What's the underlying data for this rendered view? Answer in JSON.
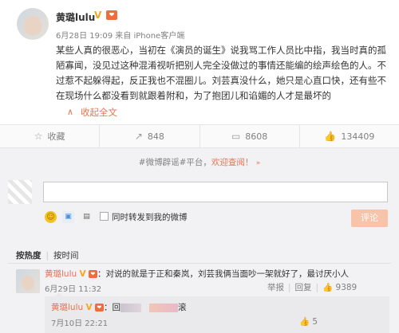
{
  "post": {
    "author": "黄璐lulu",
    "vip_badge": "V",
    "level_badge": "❤",
    "meta": "6月28日 19:09 来自 iPhone客户端",
    "content": "某些人真的很恶心，当初在《演员的诞生》说我骂工作人员比中指，我当时真的孤陋寡闻，没见过这种混淆视听把别人完全没做过的事情还能编的绘声绘色的人。不过惹不起躲得起，反正我也不混圈儿。刘芸真没什么，她只是心直口快，还有些不在现场什么都没看到就跟着附和，为了抱团儿和谄媚的人才是最坏的",
    "collapse_label": "收起全文",
    "collapse_icon": "∧"
  },
  "actions": [
    {
      "icon": "☆",
      "label": "收藏",
      "name": "favorite"
    },
    {
      "icon": "↗",
      "label": "848",
      "name": "repost"
    },
    {
      "icon": "▭",
      "label": "8608",
      "name": "comment"
    },
    {
      "icon": "👍",
      "label": "134409",
      "name": "like"
    }
  ],
  "comments_panel": {
    "notice_prefix": "#微博辟谣#平台，",
    "notice_link": "欢迎查阅！",
    "notice_chevron": "»",
    "repost_option": "同时转发到我的微博",
    "submit_label": "评论",
    "sort_hot": "按热度",
    "sort_time": "按时间"
  },
  "comment": {
    "author": "黄璐lulu",
    "vip_badge": "V",
    "text": "：对说的就是于正和秦岚，刘芸我俩当面吵一架就好了，最讨厌小人",
    "time": "6月29日 11:32",
    "report": "举报",
    "reply": "回复",
    "like_icon": "👍",
    "likes": "9389"
  },
  "reply": {
    "author": "黄璐lulu",
    "vip_badge": "V",
    "prefix": "：回",
    "suffix": "滚",
    "time": "7月10日 22:21",
    "like_icon": "👍",
    "likes": "5"
  },
  "colors": {
    "accent": "#eb7350",
    "vip": "#f5a623"
  }
}
